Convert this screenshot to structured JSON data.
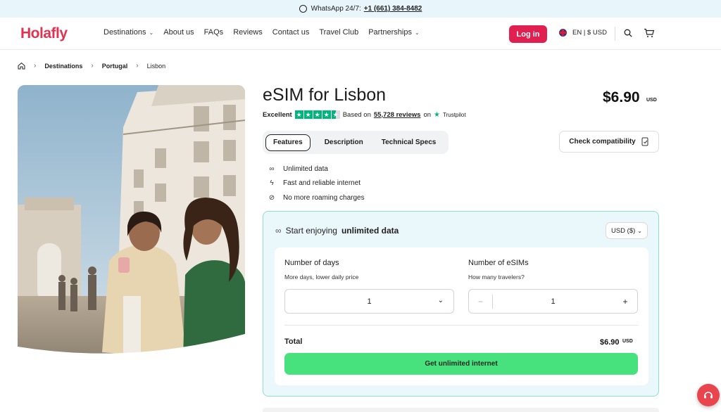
{
  "topbar": {
    "label": "WhatsApp 24/7:",
    "phone": "+1 (661) 384-8482",
    "icon": "whatsapp-icon"
  },
  "header": {
    "logo": "Holafly",
    "nav": [
      {
        "label": "Destinations",
        "dropdown": true
      },
      {
        "label": "About us",
        "dropdown": false
      },
      {
        "label": "FAQs",
        "dropdown": false
      },
      {
        "label": "Reviews",
        "dropdown": false
      },
      {
        "label": "Contact us",
        "dropdown": false
      },
      {
        "label": "Travel Club",
        "dropdown": false
      },
      {
        "label": "Partnerships",
        "dropdown": true
      }
    ],
    "login_label": "Log in",
    "language": "EN | $ USD",
    "accent_color": "#df2051"
  },
  "breadcrumb": {
    "items": [
      "Destinations",
      "Portugal",
      "Lisbon"
    ]
  },
  "product": {
    "title": "eSIM for Lisbon",
    "price": "$6.90",
    "price_currency": "USD",
    "rating": {
      "label": "Excellent",
      "based_on": "Based on",
      "reviews": "55,728 reviews",
      "on": "on",
      "source": "Trustpilot",
      "stars": 4.5
    },
    "tabs": [
      "Features",
      "Description",
      "Technical Specs"
    ],
    "active_tab": "Features",
    "check_label": "Check compatibility",
    "features": [
      {
        "icon": "infinity-icon",
        "label": "Unlimited data"
      },
      {
        "icon": "lightning-icon",
        "label": "Fast and reliable internet"
      },
      {
        "icon": "no-roaming-icon",
        "label": "No more roaming charges"
      }
    ]
  },
  "purchase": {
    "heading_prefix": "Start enjoying",
    "heading_bold": "unlimited data",
    "currency": "USD ($)",
    "days_label": "Number of days",
    "days_sub": "More days, lower daily price",
    "days_value": "1",
    "esims_label": "Number of eSIMs",
    "esims_sub": "How many travelers?",
    "esims_value": "1",
    "minus": "−",
    "plus": "+",
    "total_label": "Total",
    "total_value": "$6.90",
    "total_currency": "USD",
    "cta_label": "Get unlimited internet",
    "cta_color": "#47e27e"
  }
}
